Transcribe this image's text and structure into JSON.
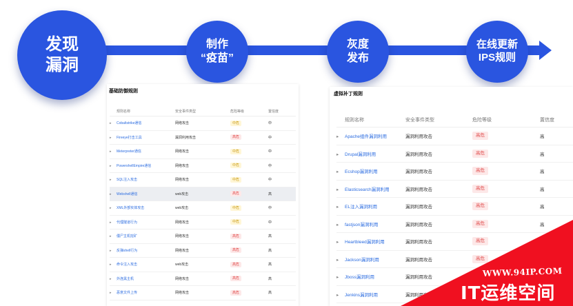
{
  "flow": {
    "stages": [
      {
        "line1": "发现",
        "line2": "漏洞"
      },
      {
        "line1": "制作",
        "line2": "“疫苗”"
      },
      {
        "line1": "灰度",
        "line2": "发布"
      },
      {
        "line1": "在线更新",
        "line2": "IPS规则"
      }
    ],
    "color": "#2a55e0"
  },
  "left_panel": {
    "title": "基础防御规则",
    "columns": [
      "规则名称",
      "安全事件类型",
      "危险等级",
      "置信度"
    ],
    "rows": [
      {
        "name": "Cobaltstrike通信",
        "type": "网络攻击",
        "level": "中危",
        "confidence": "中"
      },
      {
        "name": "Fireeye打击工具",
        "type": "漏洞利用攻击",
        "level": "高危",
        "confidence": "中"
      },
      {
        "name": "Meterpreter通信",
        "type": "网络攻击",
        "level": "中危",
        "confidence": "中"
      },
      {
        "name": "PowershellEmpire通信",
        "type": "网络攻击",
        "level": "中危",
        "confidence": "中"
      },
      {
        "name": "SQL注入攻击",
        "type": "网络攻击",
        "level": "中危",
        "confidence": "中"
      },
      {
        "name": "Webshell通信",
        "type": "web攻击",
        "level": "高危",
        "confidence": "高"
      },
      {
        "name": "XML外部实体攻击",
        "type": "web攻击",
        "level": "中危",
        "confidence": "中"
      },
      {
        "name": "代理隧道行为",
        "type": "网络攻击",
        "level": "中危",
        "confidence": "中"
      },
      {
        "name": "僵尸主机挖矿",
        "type": "网络攻击",
        "level": "高危",
        "confidence": "高"
      },
      {
        "name": "反弹shell行为",
        "type": "网络攻击",
        "level": "高危",
        "confidence": "高"
      },
      {
        "name": "命令注入攻击",
        "type": "web攻击",
        "level": "高危",
        "confidence": "高"
      },
      {
        "name": "外连黑主机",
        "type": "网络攻击",
        "level": "高危",
        "confidence": "高"
      },
      {
        "name": "恶意文件上传",
        "type": "网络攻击",
        "level": "高危",
        "confidence": "高"
      }
    ]
  },
  "right_panel": {
    "title": "虚拟补丁规则",
    "columns": [
      "规则名称",
      "安全事件类型",
      "危险等级",
      "置信度"
    ],
    "rows": [
      {
        "name": "Apache组件漏洞利用",
        "type": "漏洞利用攻击",
        "level": "高危",
        "confidence": "高"
      },
      {
        "name": "Drupal漏洞利用",
        "type": "漏洞利用攻击",
        "level": "高危",
        "confidence": "高"
      },
      {
        "name": "Ecshop漏洞利用",
        "type": "漏洞利用攻击",
        "level": "高危",
        "confidence": "高"
      },
      {
        "name": "Elasticsearch漏洞利用",
        "type": "漏洞利用攻击",
        "level": "高危",
        "confidence": "高"
      },
      {
        "name": "EL注入漏洞利用",
        "type": "漏洞利用攻击",
        "level": "高危",
        "confidence": "高"
      },
      {
        "name": "fastjson漏洞利用",
        "type": "漏洞利用攻击",
        "level": "高危",
        "confidence": "高"
      },
      {
        "name": "Heartbleed漏洞利用",
        "type": "漏洞利用攻击",
        "level": "高危",
        "confidence": ""
      },
      {
        "name": "Jackson漏洞利用",
        "type": "漏洞利用攻击",
        "level": "高危",
        "confidence": ""
      },
      {
        "name": "Jboss漏洞利用",
        "type": "漏洞利用攻击",
        "level": "",
        "confidence": ""
      },
      {
        "name": "Jenkins漏洞利用",
        "type": "漏洞利用攻击",
        "level": "",
        "confidence": ""
      }
    ]
  },
  "level_colors": {
    "中危": "#c99a10",
    "高危": "#e04848"
  },
  "icons": {
    "expand": "caret-right-icon"
  },
  "watermark": {
    "url": "WWW.94IP.COM",
    "name": "IT运维空间"
  }
}
